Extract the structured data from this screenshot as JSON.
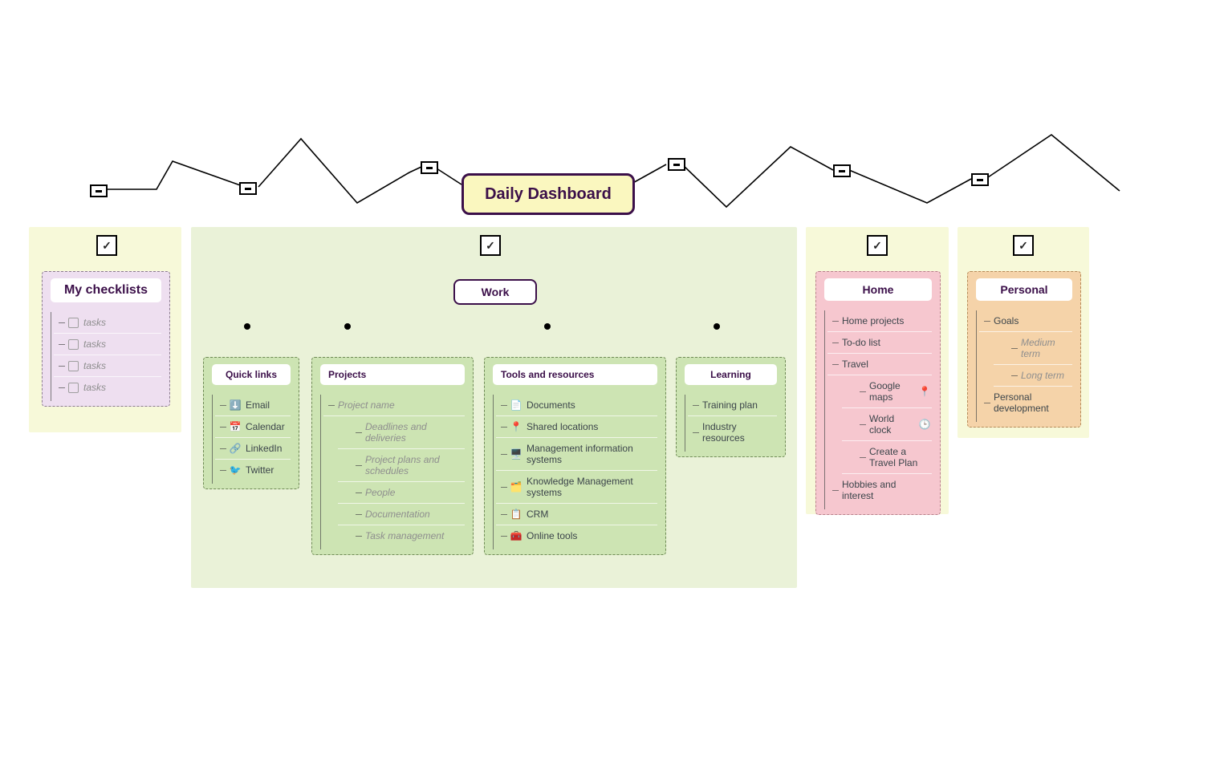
{
  "title": "Daily Dashboard",
  "checklists": {
    "title": "My checklists",
    "items": [
      "tasks",
      "tasks",
      "tasks",
      "tasks"
    ]
  },
  "work": {
    "title": "Work",
    "quickLinks": {
      "title": "Quick links",
      "items": [
        {
          "icon": "⬇️",
          "label": "Email"
        },
        {
          "icon": "📅",
          "label": "Calendar"
        },
        {
          "icon": "🔗",
          "label": "LinkedIn"
        },
        {
          "icon": "🐦",
          "label": "Twitter"
        }
      ]
    },
    "projects": {
      "title": "Projects",
      "placeholder": "Project name",
      "items": [
        "Deadlines and deliveries",
        "Project plans and schedules",
        "People",
        "Documentation",
        "Task management"
      ]
    },
    "tools": {
      "title": "Tools and resources",
      "items": [
        {
          "icon": "📄",
          "label": "Documents"
        },
        {
          "icon": "📍",
          "label": "Shared locations"
        },
        {
          "icon": "🖥️",
          "label": "Management information systems"
        },
        {
          "icon": "🗂️",
          "label": "Knowledge Management systems"
        },
        {
          "icon": "📋",
          "label": "CRM"
        },
        {
          "icon": "🧰",
          "label": "Online tools"
        }
      ]
    },
    "learning": {
      "title": "Learning",
      "items": [
        "Training plan",
        "Industry resources"
      ]
    }
  },
  "home": {
    "title": "Home",
    "items": [
      "Home projects",
      "To-do list",
      "Travel"
    ],
    "travelSub": [
      {
        "label": "Google maps",
        "icon": "📍"
      },
      {
        "label": "World clock",
        "icon": "🕒"
      },
      {
        "label": "Create a Travel Plan",
        "icon": ""
      }
    ],
    "last": "Hobbies and interest"
  },
  "personal": {
    "title": "Personal",
    "goals": "Goals",
    "goalsSub": [
      "Medium term",
      "Long term"
    ],
    "last": "Personal development"
  }
}
